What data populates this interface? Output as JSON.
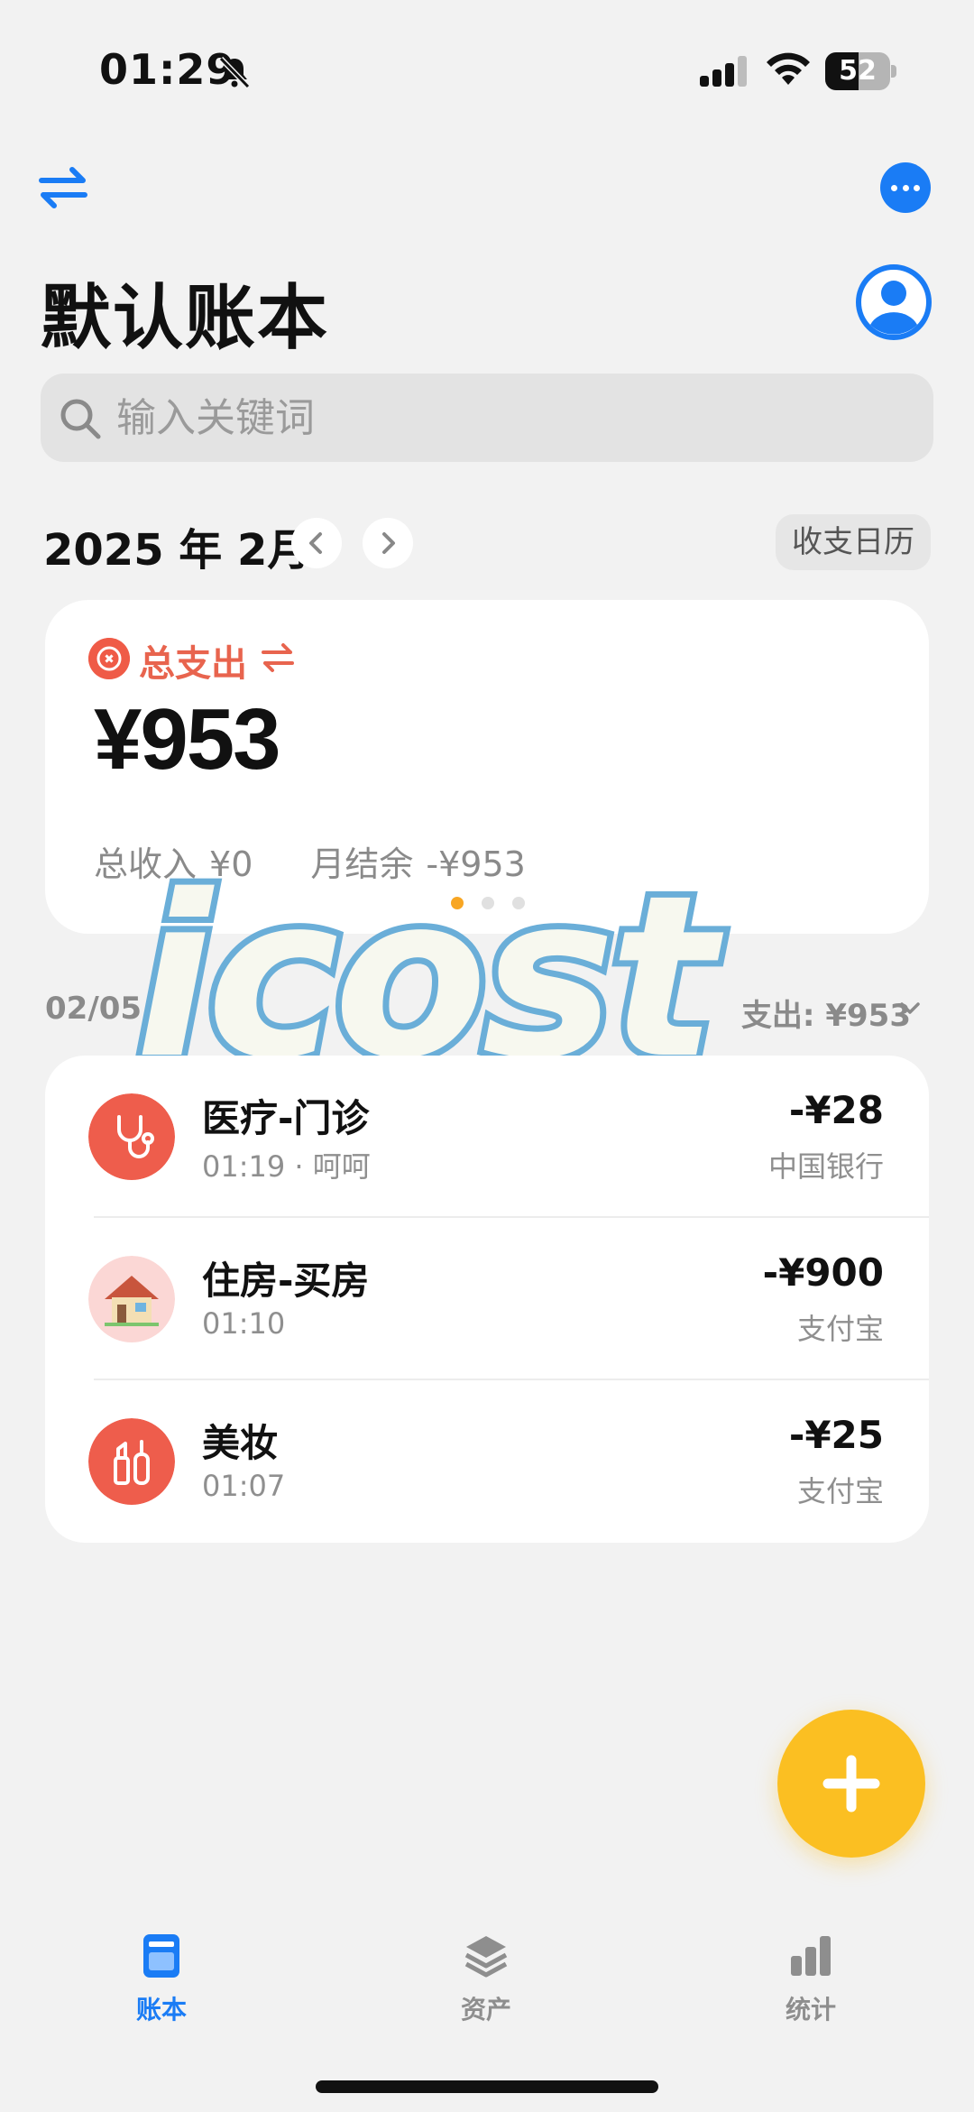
{
  "status_bar": {
    "time": "01:29",
    "battery_level": 52,
    "battery_text": "52"
  },
  "header": {
    "title": "默认账本"
  },
  "search": {
    "placeholder": "输入关键词",
    "value": ""
  },
  "month": {
    "label": "2025 年 2月",
    "calendar_button": "收支日历"
  },
  "summary": {
    "expense_label": "总支出",
    "expense_amount": "¥953",
    "income_label": "总收入",
    "income_amount": "¥0",
    "balance_label": "月结余",
    "balance_amount": "-¥953",
    "page_count": 3,
    "active_page": 1
  },
  "watermark": "icost",
  "day": {
    "date": "02/05",
    "expense_summary": "支出: ¥953"
  },
  "transactions": [
    {
      "name": "医疗-门诊",
      "time": "01:19",
      "note": "呵呵",
      "amount": "-¥28",
      "account": "中国银行",
      "icon": "stethoscope-icon"
    },
    {
      "name": "住房-买房",
      "time": "01:10",
      "note": "",
      "amount": "-¥900",
      "account": "支付宝",
      "icon": "house-icon"
    },
    {
      "name": "美妆",
      "time": "01:07",
      "note": "",
      "amount": "-¥25",
      "account": "支付宝",
      "icon": "cosmetics-icon"
    }
  ],
  "tabs": [
    {
      "label": "账本",
      "icon": "ledger-icon",
      "active": true
    },
    {
      "label": "资产",
      "icon": "layers-icon",
      "active": false
    },
    {
      "label": "统计",
      "icon": "bar-chart-icon",
      "active": false
    }
  ],
  "colors": {
    "accent": "#1a7cf5",
    "expense": "#e8644e",
    "add_button": "#fbbf22",
    "background": "#f2f2f2"
  }
}
